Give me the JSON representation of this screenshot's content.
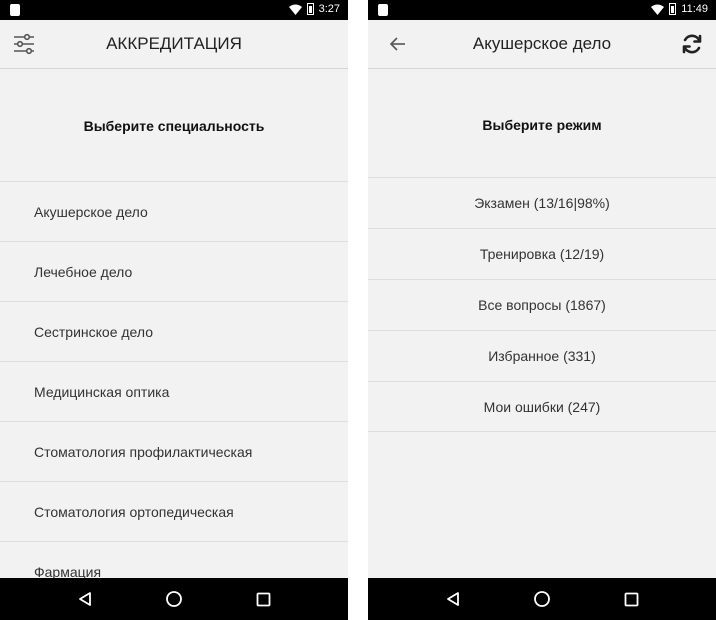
{
  "left_screen": {
    "status": {
      "time": "3:27"
    },
    "appbar": {
      "title": "АККРЕДИТАЦИЯ",
      "menu_icon": "sliders-icon"
    },
    "header": "Выберите специальность",
    "items": [
      "Акушерское дело",
      "Лечебное дело",
      "Сестринское дело",
      "Медицинская оптика",
      "Стоматология профилактическая",
      "Стоматология ортопедическая",
      "Фармация"
    ]
  },
  "right_screen": {
    "status": {
      "time": "11:49"
    },
    "appbar": {
      "title": "Акушерское дело",
      "back_icon": "arrow-left-icon",
      "action_icon": "refresh-icon"
    },
    "header": "Выберите режим",
    "items": [
      "Экзамен (13/16|98%)",
      "Тренировка (12/19)",
      "Все вопросы (1867)",
      "Избранное (331)",
      "Мои ошибки (247)"
    ]
  },
  "navbar": {
    "back_icon": "triangle-back-icon",
    "home_icon": "circle-home-icon",
    "recents_icon": "square-recents-icon"
  },
  "colors": {
    "background": "#f2f2f2",
    "statusbar": "#000000",
    "divider": "#dedede",
    "text": "#333333"
  }
}
